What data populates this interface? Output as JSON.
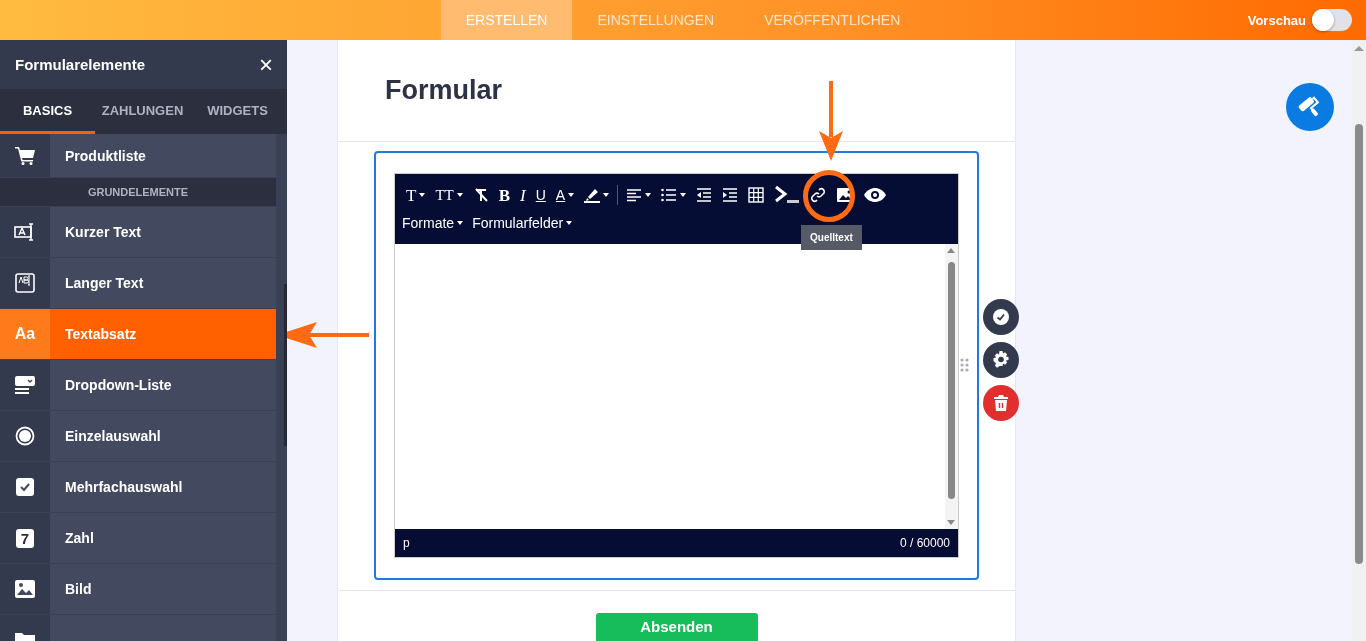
{
  "top_nav": {
    "tabs": [
      {
        "label": "ERSTELLEN",
        "selected": true
      },
      {
        "label": "EINSTELLUNGEN",
        "selected": false
      },
      {
        "label": "VERÖFFENTLICHEN",
        "selected": false
      }
    ],
    "preview": {
      "label": "Vorschau",
      "on": false
    }
  },
  "sidebar": {
    "title": "Formularelemente",
    "close": "×",
    "tabs": [
      {
        "label": "BASICS",
        "selected": true
      },
      {
        "label": "ZAHLUNGEN",
        "selected": false
      },
      {
        "label": "WIDGETS",
        "selected": false
      }
    ],
    "items": [
      {
        "kind": "element",
        "label": "Produktliste",
        "selected": false
      },
      {
        "kind": "heading",
        "label": "GRUNDELEMENTE"
      },
      {
        "kind": "element",
        "label": "Kurzer Text",
        "selected": false
      },
      {
        "kind": "element",
        "label": "Langer Text",
        "selected": false
      },
      {
        "kind": "element",
        "label": "Textabsatz",
        "icon_text": "Aa",
        "selected": true
      },
      {
        "kind": "element",
        "label": "Dropdown-Liste",
        "selected": false
      },
      {
        "kind": "element",
        "label": "Einzelauswahl",
        "selected": false
      },
      {
        "kind": "element",
        "label": "Mehrfachauswahl",
        "selected": false
      },
      {
        "kind": "element",
        "label": "Zahl",
        "icon_text": "7",
        "selected": false
      },
      {
        "kind": "element",
        "label": "Bild",
        "selected": false
      },
      {
        "kind": "element",
        "selected": false
      }
    ]
  },
  "form": {
    "title": "Formular",
    "editor": {
      "tools": [
        {
          "kind": "text-style",
          "glyph": "T",
          "dropdown": true
        },
        {
          "kind": "font-size",
          "glyph": "TT",
          "dropdown": true
        },
        {
          "kind": "clear-format",
          "dropdown": false
        },
        {
          "kind": "bold",
          "glyph": "B",
          "dropdown": false
        },
        {
          "kind": "italic",
          "glyph": "I",
          "dropdown": false
        },
        {
          "kind": "underline",
          "glyph": "U",
          "dropdown": false
        },
        {
          "kind": "font-color",
          "glyph": "A",
          "dropdown": true
        },
        {
          "kind": "highlight",
          "dropdown": true
        },
        {
          "kind": "separator"
        },
        {
          "kind": "align",
          "dropdown": true
        },
        {
          "kind": "list",
          "dropdown": true
        },
        {
          "kind": "outdent",
          "dropdown": false
        },
        {
          "kind": "indent",
          "dropdown": false
        },
        {
          "kind": "table",
          "dropdown": false
        },
        {
          "kind": "source",
          "dropdown": false
        },
        {
          "kind": "link",
          "dropdown": false
        },
        {
          "kind": "image",
          "dropdown": false
        },
        {
          "kind": "preview",
          "dropdown": false
        }
      ],
      "menus": [
        "Formate",
        "Formularfelder"
      ],
      "tooltip": "Quelltext",
      "path": "p",
      "counter": "0 / 60000"
    },
    "submit": "Absenden"
  }
}
